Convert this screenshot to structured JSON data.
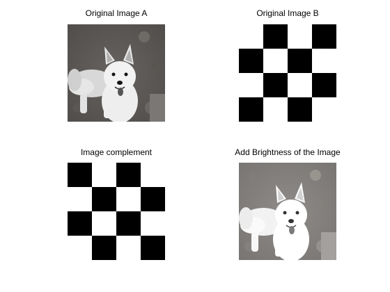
{
  "panels": [
    {
      "title": "Original Image A",
      "image": "grayscale photo of a white dog"
    },
    {
      "title": "Original Image B",
      "image": "black and white checkerboard"
    },
    {
      "title": "Image complement",
      "image": "inverted black and white checkerboard"
    },
    {
      "title": "Add Brightness of the Image",
      "image": "brightened grayscale photo of a white dog"
    }
  ],
  "checkerboard": {
    "rows": 4,
    "cols": 4,
    "pattern_b": [
      [
        0,
        1,
        0,
        1
      ],
      [
        1,
        0,
        1,
        0
      ],
      [
        0,
        1,
        0,
        1
      ],
      [
        1,
        0,
        1,
        0
      ]
    ],
    "pattern_complement": [
      [
        1,
        0,
        1,
        0
      ],
      [
        0,
        1,
        0,
        1
      ],
      [
        1,
        0,
        1,
        0
      ],
      [
        0,
        1,
        0,
        1
      ]
    ]
  },
  "colors": {
    "background": "#ffffff",
    "black": "#000000",
    "white": "#ffffff",
    "ground_dark": "#5e5b58",
    "ground_bright": "#858380"
  }
}
